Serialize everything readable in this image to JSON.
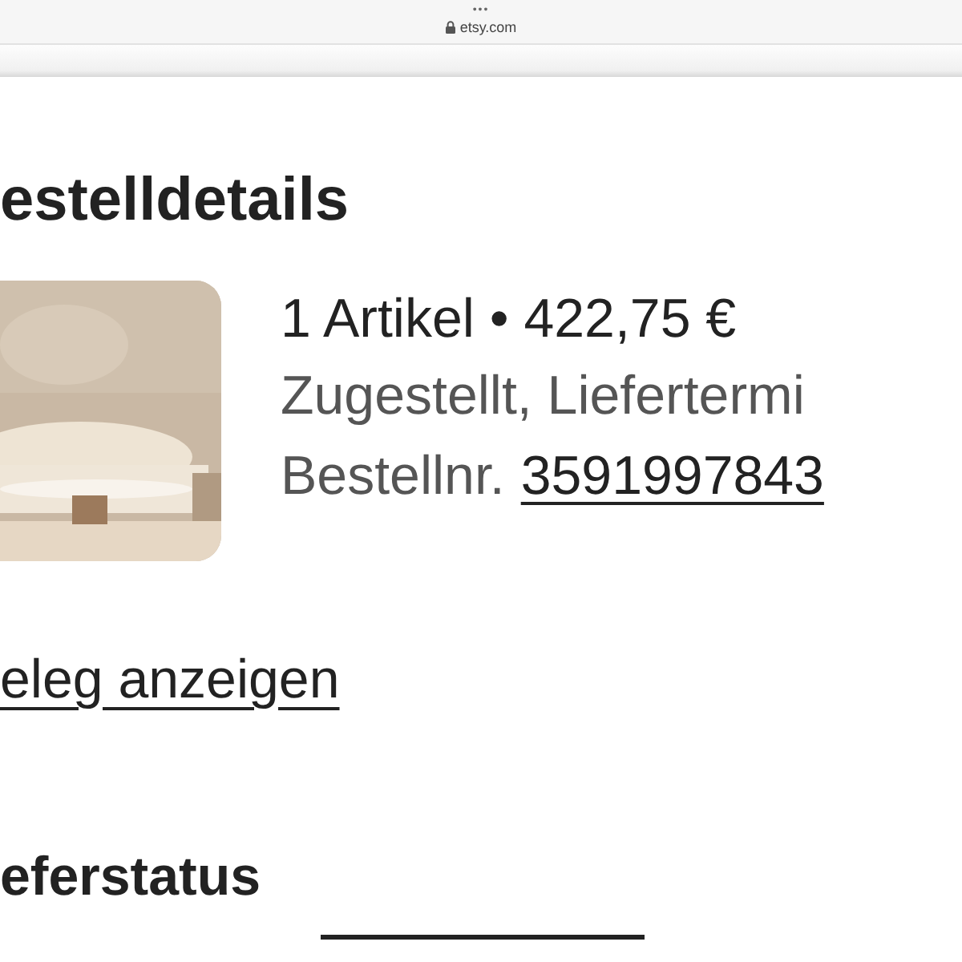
{
  "browser": {
    "menu_dots": "•••",
    "address": "etsy.com"
  },
  "title": "estelldetails",
  "order": {
    "summary": "1 Artikel • 422,75 €",
    "status": "Zugestellt, Liefertermi",
    "number_label": "Bestellnr.",
    "number": "3591997843"
  },
  "receipt_link": "eleg anzeigen",
  "section_title": "eferstatus"
}
